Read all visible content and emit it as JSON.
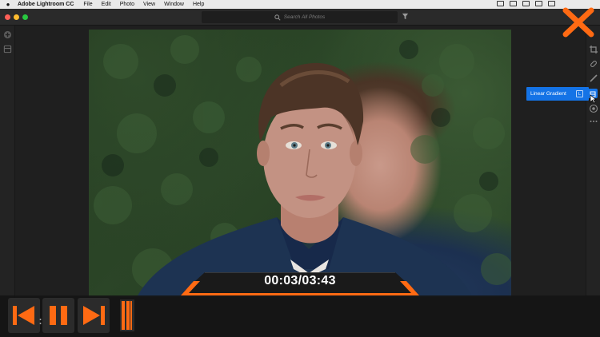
{
  "menubar": {
    "app_name": "Adobe Lightroom CC",
    "items": [
      "File",
      "Edit",
      "Photo",
      "View",
      "Window",
      "Help"
    ]
  },
  "search": {
    "placeholder": "Search All Photos"
  },
  "tooltip": {
    "label": "Linear Gradient",
    "shortcut": "L"
  },
  "video": {
    "timecode": "00:03/03:43",
    "accent": "#ff6a13",
    "progress": 0.0135
  },
  "colors": {
    "accent_blue": "#1473e6",
    "accent_orange": "#ff6a13"
  },
  "icons": {
    "left_rail": [
      "add-icon",
      "library-icon"
    ],
    "right_rail": [
      "crop-icon",
      "healing-brush-icon",
      "brush-icon",
      "linear-gradient-icon",
      "radial-gradient-icon",
      "more-icon"
    ],
    "player": [
      "skip-back-icon",
      "pause-icon",
      "skip-forward-icon"
    ]
  }
}
